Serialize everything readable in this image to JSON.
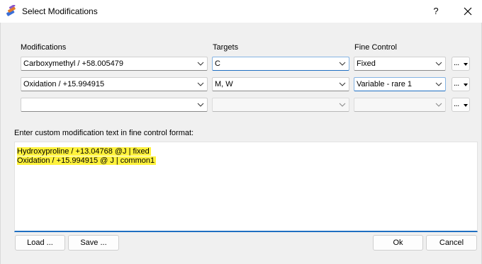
{
  "window": {
    "title": "Select Modifications",
    "help": "?"
  },
  "columns": {
    "modifications": "Modifications",
    "targets": "Targets",
    "fine_control": "Fine Control"
  },
  "rows": [
    {
      "modification": "Carboxymethyl / +58.005479",
      "targets": "C",
      "fine_control": "Fixed",
      "more": "..."
    },
    {
      "modification": "Oxidation / +15.994915",
      "targets": "M, W",
      "fine_control": "Variable - rare 1",
      "more": "..."
    },
    {
      "modification": "",
      "targets": "",
      "fine_control": "",
      "more": "..."
    }
  ],
  "custom": {
    "label": "Enter custom modification text in fine control format:",
    "lines": [
      "Hydroxyproline / +13.04768 @J | fixed",
      "Oxidation / +15.994915 @ J | common1"
    ],
    "highlight_color": "#fff23c"
  },
  "buttons": {
    "load": "Load ...",
    "save": "Save ...",
    "ok": "Ok",
    "cancel": "Cancel"
  },
  "colors": {
    "accent": "#1f6fc2",
    "background": "#f0f0f0"
  }
}
